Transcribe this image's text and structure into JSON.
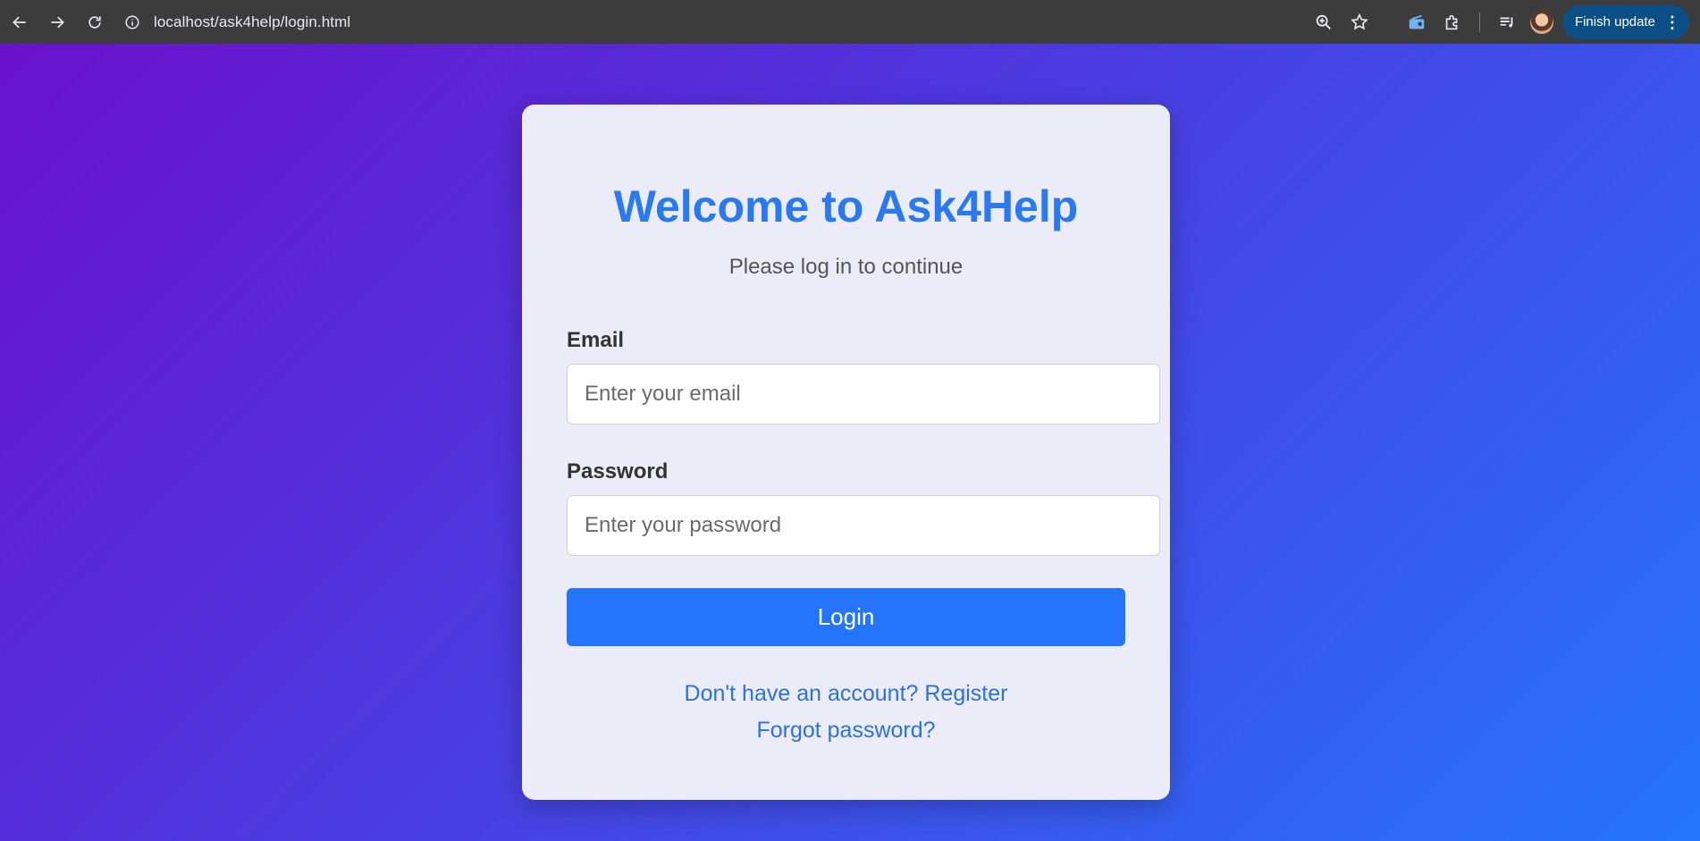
{
  "browser": {
    "url": "localhost/ask4help/login.html",
    "update_label": "Finish update"
  },
  "login": {
    "title": "Welcome to Ask4Help",
    "subtitle": "Please log in to continue",
    "email_label": "Email",
    "email_placeholder": "Enter your email",
    "password_label": "Password",
    "password_placeholder": "Enter your password",
    "login_button": "Login",
    "register_link": "Don't have an account? Register",
    "forgot_link": "Forgot password?"
  },
  "colors": {
    "accent": "#2575fc",
    "title": "#2979f2",
    "gradient_start": "#6a11cb",
    "gradient_end": "#2575fc",
    "card_bg": "#ecebf8"
  }
}
